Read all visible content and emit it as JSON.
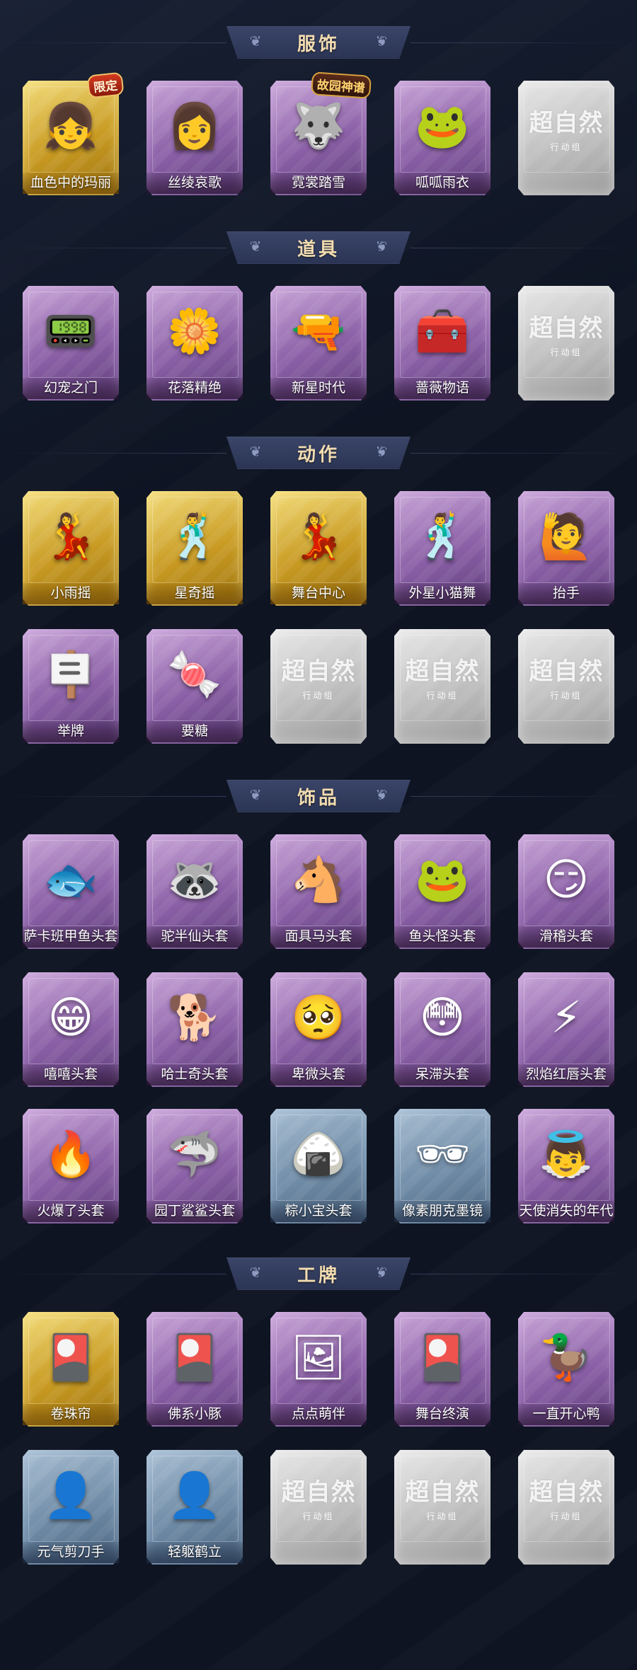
{
  "sections": [
    {
      "title": "服饰",
      "rows": [
        [
          {
            "label": "血色中的玛丽",
            "rarity": "gold",
            "icon": "girl-red-hood-icon",
            "glyph": "👧",
            "badge": "限定"
          },
          {
            "label": "丝绫哀歌",
            "rarity": "purple",
            "icon": "gothic-girl-icon",
            "glyph": "👩"
          },
          {
            "label": "霓裳踏雪",
            "rarity": "purple",
            "icon": "wolf-eared-boy-icon",
            "glyph": "🐺",
            "badge": "故园神谱"
          },
          {
            "label": "呱呱雨衣",
            "rarity": "purple",
            "icon": "frog-raincoat-girl-icon",
            "glyph": "🐸"
          },
          {
            "label": "",
            "rarity": "empty",
            "icon": "placeholder-icon",
            "glyph": ""
          }
        ]
      ]
    },
    {
      "title": "道具",
      "rows": [
        [
          {
            "label": "幻宠之门",
            "rarity": "purple",
            "icon": "pet-device-icon",
            "glyph": "📟"
          },
          {
            "label": "花落精绝",
            "rarity": "purple",
            "icon": "flower-necklace-icon",
            "glyph": "🌼"
          },
          {
            "label": "新星时代",
            "rarity": "purple",
            "icon": "revolver-icon",
            "glyph": "🔫"
          },
          {
            "label": "蔷薇物语",
            "rarity": "purple",
            "icon": "medkit-icon",
            "glyph": "🧰"
          },
          {
            "label": "",
            "rarity": "empty",
            "icon": "placeholder-icon",
            "glyph": ""
          }
        ]
      ]
    },
    {
      "title": "动作",
      "rows": [
        [
          {
            "label": "小雨摇",
            "rarity": "gold",
            "icon": "dance-pose-icon",
            "glyph": "💃"
          },
          {
            "label": "星奇摇",
            "rarity": "gold",
            "icon": "dance-pose-icon",
            "glyph": "🕺"
          },
          {
            "label": "舞台中心",
            "rarity": "gold",
            "icon": "dance-pose-icon",
            "glyph": "💃"
          },
          {
            "label": "外星小猫舞",
            "rarity": "purple",
            "icon": "dance-pose-icon",
            "glyph": "🕺"
          },
          {
            "label": "抬手",
            "rarity": "purple",
            "icon": "raise-hand-icon",
            "glyph": "🙋"
          }
        ],
        [
          {
            "label": "举牌",
            "rarity": "purple",
            "icon": "hold-sign-icon",
            "glyph": "🪧"
          },
          {
            "label": "要糖",
            "rarity": "purple",
            "icon": "ask-candy-icon",
            "glyph": "🍬"
          },
          {
            "label": "",
            "rarity": "empty",
            "icon": "placeholder-icon",
            "glyph": ""
          },
          {
            "label": "",
            "rarity": "empty",
            "icon": "placeholder-icon",
            "glyph": ""
          },
          {
            "label": "",
            "rarity": "empty",
            "icon": "placeholder-icon",
            "glyph": ""
          }
        ]
      ]
    },
    {
      "title": "饰品",
      "rows": [
        [
          {
            "label": "萨卡班甲鱼头套",
            "rarity": "purple",
            "icon": "fish-head-icon",
            "glyph": "🐟"
          },
          {
            "label": "驼半仙头套",
            "rarity": "purple",
            "icon": "raccoon-head-icon",
            "glyph": "🦝"
          },
          {
            "label": "面具马头套",
            "rarity": "purple",
            "icon": "horse-head-icon",
            "glyph": "🐴"
          },
          {
            "label": "鱼头怪头套",
            "rarity": "purple",
            "icon": "fish-monster-head-icon",
            "glyph": "🐸"
          },
          {
            "label": "滑稽头套",
            "rarity": "purple",
            "icon": "funny-face-icon",
            "glyph": "😏"
          }
        ],
        [
          {
            "label": "嘻嘻头套",
            "rarity": "purple",
            "icon": "grin-face-icon",
            "glyph": "😁"
          },
          {
            "label": "哈士奇头套",
            "rarity": "purple",
            "icon": "husky-head-icon",
            "glyph": "🐕"
          },
          {
            "label": "卑微头套",
            "rarity": "purple",
            "icon": "humble-face-icon",
            "glyph": "🥺"
          },
          {
            "label": "呆滞头套",
            "rarity": "purple",
            "icon": "dazed-face-icon",
            "glyph": "😳"
          },
          {
            "label": "烈焰红唇头套",
            "rarity": "purple",
            "icon": "pikachu-head-icon",
            "glyph": "⚡"
          }
        ],
        [
          {
            "label": "火爆了头套",
            "rarity": "purple",
            "icon": "fire-head-icon",
            "glyph": "🔥"
          },
          {
            "label": "园丁鲨鲨头套",
            "rarity": "purple",
            "icon": "shark-head-icon",
            "glyph": "🦈"
          },
          {
            "label": "粽小宝头套",
            "rarity": "blue",
            "icon": "zongzi-head-icon",
            "glyph": "🍙"
          },
          {
            "label": "像素朋克墨镜",
            "rarity": "blue",
            "icon": "pixel-sunglasses-icon",
            "glyph": "🕶"
          },
          {
            "label": "天使消失的年代",
            "rarity": "purple",
            "icon": "angel-doll-icon",
            "glyph": "👼"
          }
        ]
      ]
    },
    {
      "title": "工牌",
      "rows": [
        [
          {
            "label": "卷珠帘",
            "rarity": "gold",
            "icon": "badge-card-icon",
            "glyph": "🎴"
          },
          {
            "label": "佛系小豚",
            "rarity": "purple",
            "icon": "badge-card-icon",
            "glyph": "🎴"
          },
          {
            "label": "点点萌伴",
            "rarity": "purple",
            "icon": "badge-card-icon",
            "glyph": "🖼"
          },
          {
            "label": "舞台终演",
            "rarity": "purple",
            "icon": "badge-card-icon",
            "glyph": "🎴"
          },
          {
            "label": "一直开心鸭",
            "rarity": "purple",
            "icon": "badge-card-icon",
            "glyph": "🦆"
          }
        ],
        [
          {
            "label": "元气剪刀手",
            "rarity": "blue",
            "icon": "silhouette-card-icon",
            "glyph": "👤"
          },
          {
            "label": "轻躯鹤立",
            "rarity": "blue",
            "icon": "silhouette-card-icon",
            "glyph": "👤"
          },
          {
            "label": "",
            "rarity": "empty",
            "icon": "placeholder-icon",
            "glyph": ""
          },
          {
            "label": "",
            "rarity": "empty",
            "icon": "placeholder-icon",
            "glyph": ""
          },
          {
            "label": "",
            "rarity": "empty",
            "icon": "placeholder-icon",
            "glyph": ""
          }
        ]
      ]
    }
  ],
  "placeholder": {
    "title": "超自然",
    "subtitle": "行动组"
  },
  "colors": {
    "background": "#0e1422",
    "banner": "#2b3454",
    "title": "#f2dcb0",
    "gold": "#c89a22",
    "purple": "#8a5fa6",
    "blue": "#6f8ba6",
    "empty": "#bfbfbf"
  }
}
